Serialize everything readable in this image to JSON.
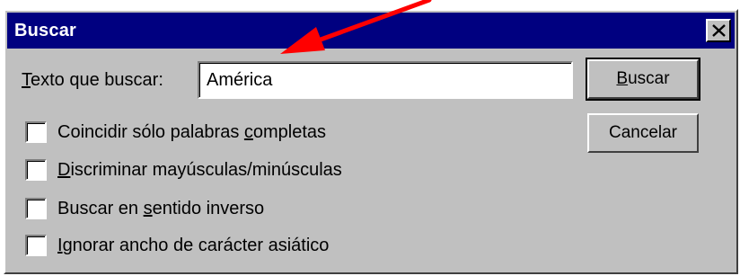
{
  "dialog": {
    "title": "Buscar",
    "close_symbol": "close-icon"
  },
  "find_field": {
    "label_first": "T",
    "label_rest": "exto que buscar:",
    "value": "América"
  },
  "buttons": {
    "find_first": "B",
    "find_rest": "uscar",
    "cancel": "Cancelar"
  },
  "options": [
    {
      "pre": "Coincidir sólo palabras ",
      "key": "c",
      "post": "ompletas",
      "checked": false
    },
    {
      "pre": "",
      "key": "D",
      "post": "iscriminar mayúsculas/minúsculas",
      "checked": false
    },
    {
      "pre": "Buscar en ",
      "key": "s",
      "post": "entido inverso",
      "checked": false
    },
    {
      "pre": "",
      "key": "I",
      "post": "gnorar ancho de carácter asiático",
      "checked": false
    }
  ],
  "colors": {
    "titlebar": "#000080",
    "face": "#c0c0c0",
    "arrow": "#ff0000"
  }
}
